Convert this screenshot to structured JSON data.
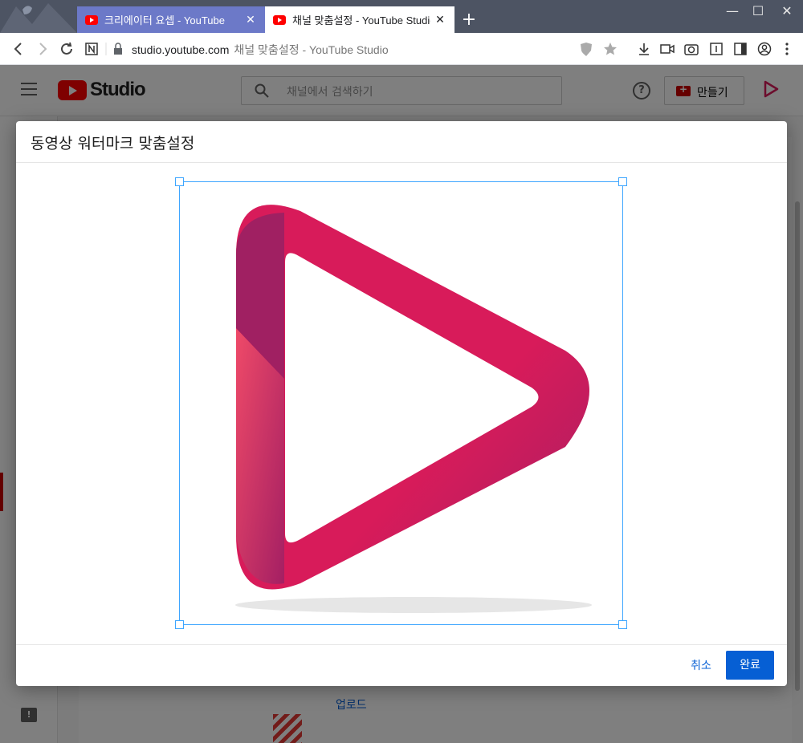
{
  "browser": {
    "tabs": [
      {
        "title": "크리에이터 요셉 - YouTube",
        "active": false
      },
      {
        "title": "채널 맞춤설정 - YouTube Studio",
        "active": true
      }
    ],
    "new_tab": "+",
    "url_host": "studio.youtube.com",
    "page_title": "채널 맞춤설정 - YouTube Studio",
    "window_controls": {
      "minimize": "—",
      "maximize": "☐",
      "close": "✕"
    }
  },
  "studio": {
    "brand": "Studio",
    "search_placeholder": "채널에서 검색하기",
    "create_label": "만들기",
    "help": "?",
    "upload_link": "업로드"
  },
  "dialog": {
    "title": "동영상 워터마크 맞춤설정",
    "cancel_label": "취소",
    "done_label": "완료"
  },
  "colors": {
    "accent_blue": "#065fd4",
    "crop_border": "#3ea6ff",
    "logo_primary": "#d81b5a",
    "logo_dark": "#9e1e62"
  }
}
